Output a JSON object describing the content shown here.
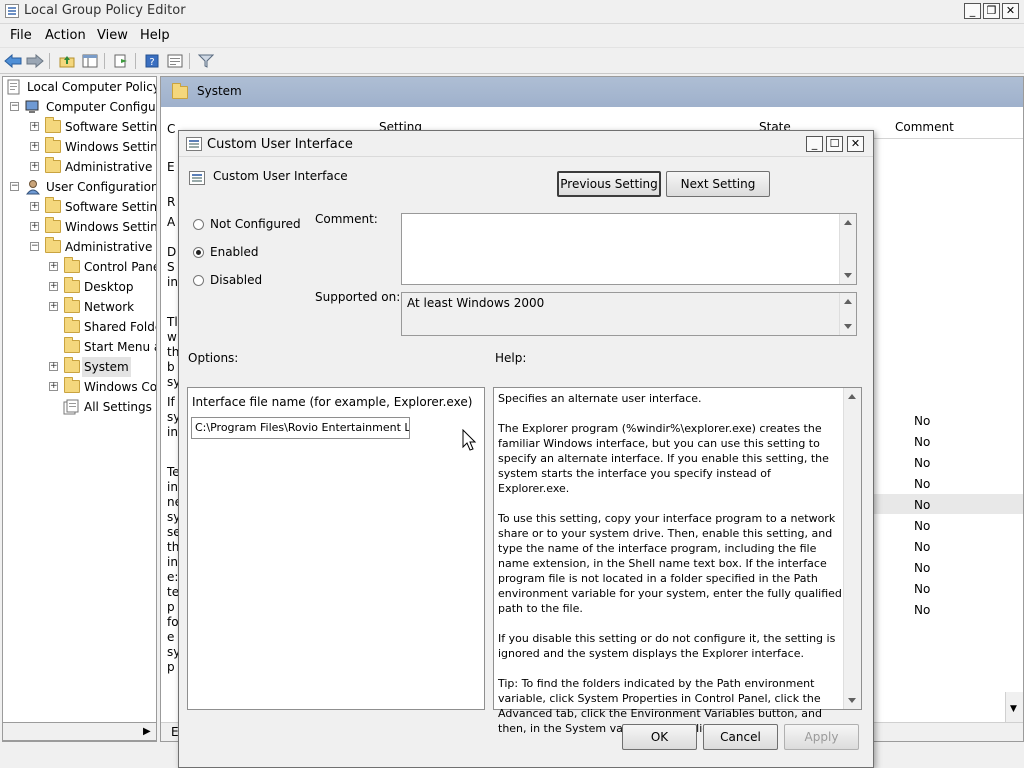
{
  "window": {
    "title": "Local Group Policy Editor"
  },
  "menu": [
    "File",
    "Action",
    "View",
    "Help"
  ],
  "toolbar_icons": [
    "back-arrow-icon",
    "forward-arrow-icon",
    "up-folder-icon",
    "show-hide-tree-icon",
    "export-list-icon",
    "help-icon",
    "properties-icon",
    "filter-icon"
  ],
  "tree": [
    {
      "label": "Local Computer Policy",
      "icon": "policy-icon",
      "expander": ""
    },
    {
      "label": "Computer Configura",
      "icon": "computer-icon",
      "expander": "−"
    },
    {
      "label": "Software Setting",
      "icon": "folder-icon",
      "expander": "+"
    },
    {
      "label": "Windows Setting",
      "icon": "folder-icon",
      "expander": "+"
    },
    {
      "label": "Administrative Te",
      "icon": "folder-icon",
      "expander": "+"
    },
    {
      "label": "User Configuration",
      "icon": "user-icon",
      "expander": "−"
    },
    {
      "label": "Software Setting",
      "icon": "folder-icon",
      "expander": "+"
    },
    {
      "label": "Windows Setting",
      "icon": "folder-icon",
      "expander": "+"
    },
    {
      "label": "Administrative Te",
      "icon": "folder-icon",
      "expander": "−"
    },
    {
      "label": "Control Pane",
      "icon": "folder-icon",
      "expander": "+"
    },
    {
      "label": "Desktop",
      "icon": "folder-icon",
      "expander": "+"
    },
    {
      "label": "Network",
      "icon": "folder-icon",
      "expander": "+"
    },
    {
      "label": "Shared Folde",
      "icon": "folder-icon",
      "expander": ""
    },
    {
      "label": "Start Menu ar",
      "icon": "folder-icon",
      "expander": ""
    },
    {
      "label": "System",
      "icon": "folder-icon",
      "expander": "+"
    },
    {
      "label": "Windows Co",
      "icon": "folder-icon",
      "expander": "+"
    },
    {
      "label": "All Settings",
      "icon": "all-settings-icon",
      "expander": ""
    }
  ],
  "right_pane": {
    "header": "System",
    "columns": [
      "Setting",
      "State",
      "Comment"
    ],
    "no_values": [
      "No",
      "No",
      "No",
      "No",
      "No",
      "No",
      "No",
      "No",
      "No",
      "No"
    ],
    "desc_fragments": [
      "C",
      "E",
      "R",
      "A",
      "D",
      "S",
      "in",
      "Tl",
      "w",
      "th",
      "b",
      "sy",
      "If",
      "sy",
      "in",
      "Te",
      "in",
      "ne",
      "sy",
      "se",
      "th",
      "in",
      "e:",
      "te",
      "p",
      "fo",
      "e",
      "sy",
      "p"
    ],
    "bottom_tab": "E"
  },
  "dialog": {
    "title": "Custom User Interface",
    "setting_name": "Custom User Interface",
    "prev_button": "Previous Setting",
    "next_button": "Next Setting",
    "radio": {
      "not_configured": "Not Configured",
      "enabled": "Enabled",
      "disabled": "Disabled",
      "selected": "Enabled"
    },
    "comment_label": "Comment:",
    "comment_value": "",
    "supported_label": "Supported on:",
    "supported_value": "At least Windows 2000",
    "options_label": "Options:",
    "help_label": "Help:",
    "option_field_label": "Interface file name (for example, Explorer.exe)",
    "option_field_value": "C:\\Program Files\\Rovio Entertainment Lt",
    "help_paragraphs": [
      "Specifies an alternate user interface.",
      "The Explorer program (%windir%\\explorer.exe) creates the familiar Windows interface, but you can use this setting to specify an alternate interface. If you enable this setting, the system starts the interface you specify instead of Explorer.exe.",
      "To use this setting, copy your interface program to a network share or to your system drive. Then, enable this setting, and type the name of the interface program, including the file name extension, in the Shell name text box. If the interface program file is not located in a folder specified in the Path environment variable for your system, enter the fully qualified path to the file.",
      "If you disable this setting or do not configure it, the setting is ignored and the system displays the Explorer interface.",
      "Tip: To find the folders indicated by the Path environment variable, click System Properties in Control Panel, click the Advanced tab, click the Environment Variables button, and then, in the System variables box, click Path."
    ],
    "ok": "OK",
    "cancel": "Cancel",
    "apply": "Apply"
  }
}
